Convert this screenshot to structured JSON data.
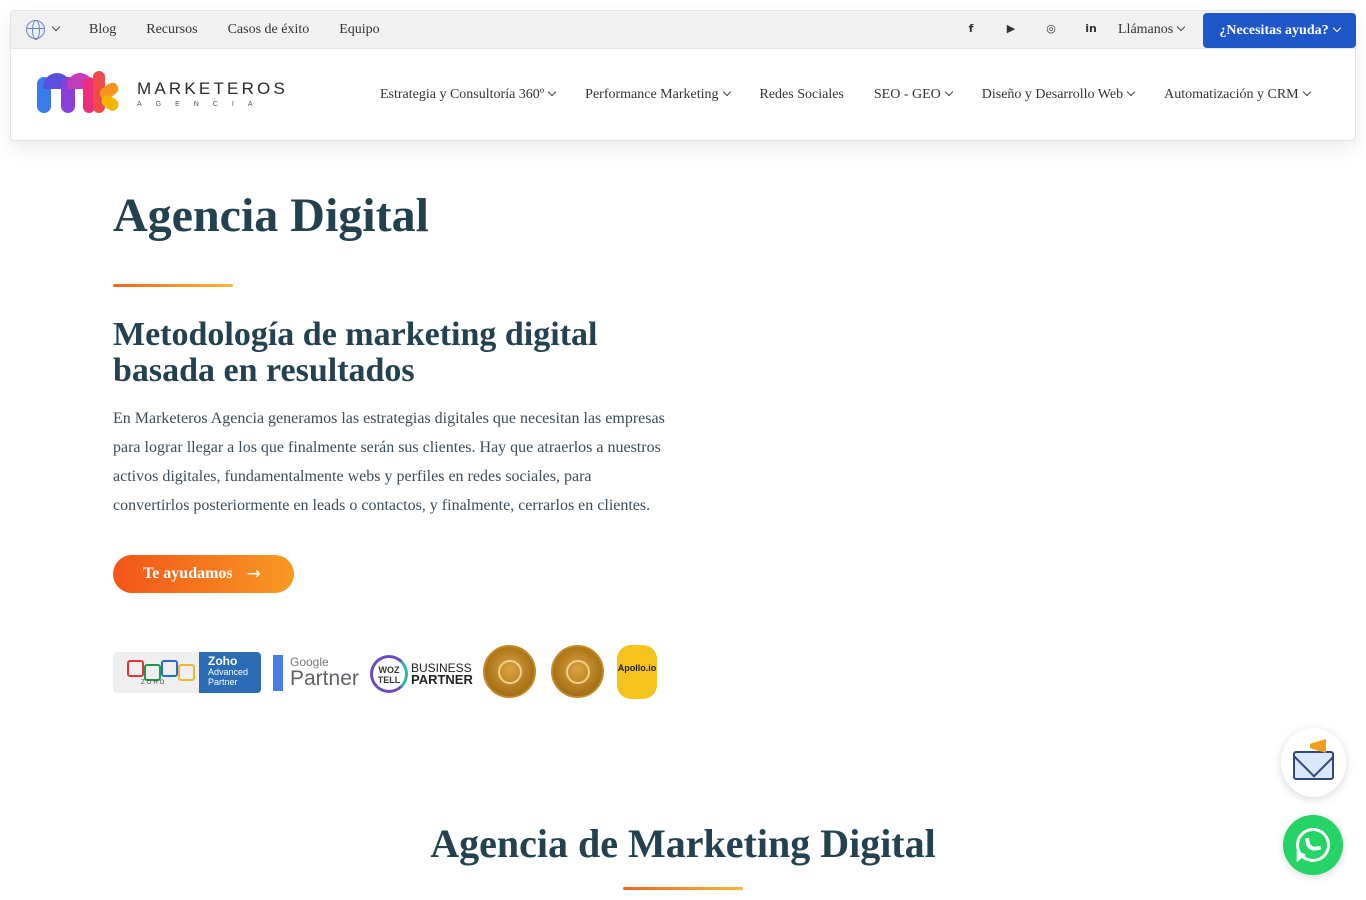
{
  "topbar": {
    "nav": [
      "Blog",
      "Recursos",
      "Casos de éxito",
      "Equipo"
    ],
    "socials": [
      {
        "icon": "facebook-icon",
        "glyph": "f"
      },
      {
        "icon": "youtube-icon",
        "glyph": "▶"
      },
      {
        "icon": "instagram-icon",
        "glyph": "◎"
      },
      {
        "icon": "linkedin-icon",
        "glyph": "in"
      }
    ],
    "call_label": "Llámanos",
    "help_label": "¿Necesitas ayuda?"
  },
  "brand": {
    "name": "MARKETEROS",
    "sub": "AGENCIA"
  },
  "main_nav": [
    {
      "label": "Estrategia y Consultoría 360º",
      "dropdown": true
    },
    {
      "label": "Performance Marketing",
      "dropdown": true
    },
    {
      "label": "Redes Sociales",
      "dropdown": false
    },
    {
      "label": "SEO - GEO",
      "dropdown": true
    },
    {
      "label": "Diseño y Desarrollo Web",
      "dropdown": true
    },
    {
      "label": "Automatización y CRM",
      "dropdown": true
    }
  ],
  "hero": {
    "title": "Agencia Digital",
    "subtitle": "Metodología de marketing digital basada en resultados",
    "paragraph": "En Marketeros Agencia generamos las estrategias digitales que necesitan las empresas para lograr llegar a los que finalmente serán sus clientes. Hay que atraerlos a nuestros activos digitales, fundamentalmente webs y perfiles en redes sociales, para convertirlos posteriormente en leads o contactos, y finalmente, cerrarlos en clientes.",
    "cta_label": "Te ayudamos",
    "cta_arrow": "→"
  },
  "badges": {
    "zoho_word": "ZOHO",
    "zoho_title": "Zoho",
    "zoho_line2": "Advanced",
    "zoho_line3": "Partner",
    "google_line1": "Google",
    "google_line2": "Partner",
    "woz_logo": "WOZ TELL",
    "woz_line1": "BUSINESS",
    "woz_line2": "PARTNER",
    "apollo": "Apollo.io"
  },
  "section2": {
    "title": "Agencia de Marketing Digital"
  },
  "colors": {
    "primary_blue": "#1f57c9",
    "heading": "#24414f",
    "accent_orange": "#f2541a",
    "whatsapp_green": "#25d366"
  }
}
